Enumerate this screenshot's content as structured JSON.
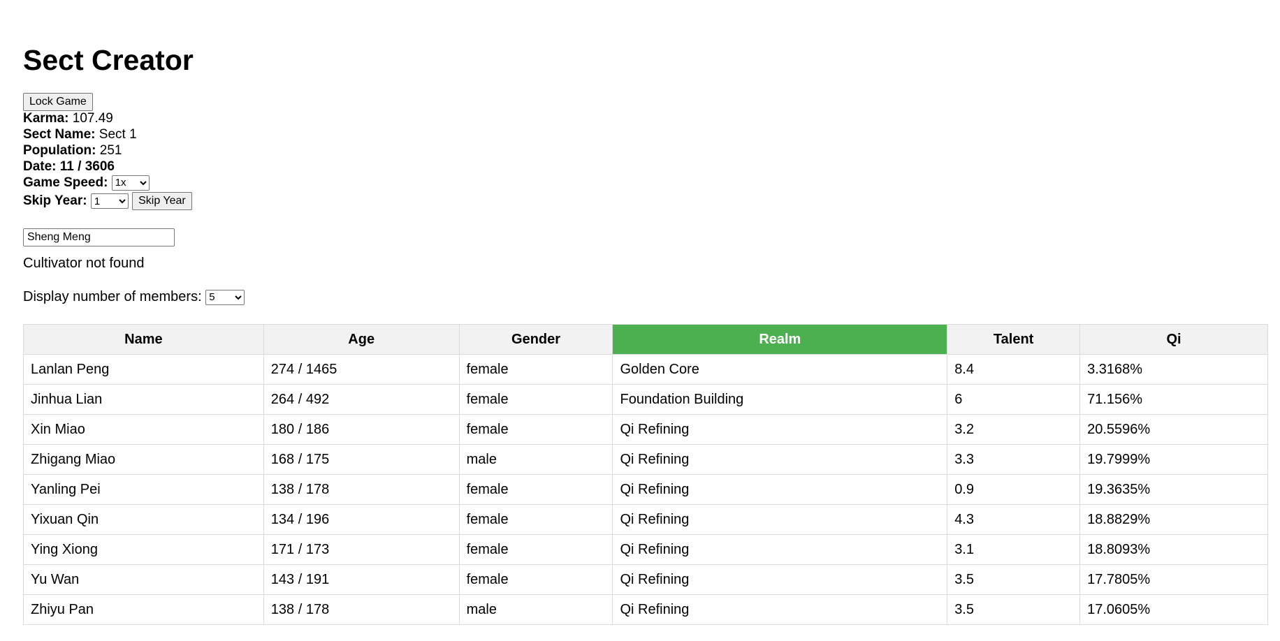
{
  "app": {
    "title": "Sect Creator"
  },
  "controls": {
    "lock_button": "Lock Game",
    "karma_label": "Karma:",
    "karma_value": "107.49",
    "sect_name_label": "Sect Name:",
    "sect_name_value": "Sect 1",
    "population_label": "Population:",
    "population_value": "251",
    "date_text": "Date: 11 / 3606",
    "game_speed_label": "Game Speed:",
    "game_speed_value": "1x",
    "skip_year_label": "Skip Year:",
    "skip_year_value": "1",
    "skip_year_button": "Skip Year"
  },
  "search": {
    "value": "Sheng Meng",
    "status": "Cultivator not found"
  },
  "display": {
    "label": "Display number of members:",
    "value": "5"
  },
  "table": {
    "headers": [
      "Name",
      "Age",
      "Gender",
      "Realm",
      "Talent",
      "Qi"
    ],
    "sorted_column": "Realm",
    "sorted_color": "#4caf50",
    "rows": [
      [
        "Lanlan Peng",
        "274 / 1465",
        "female",
        "Golden Core",
        "8.4",
        "3.3168%"
      ],
      [
        "Jinhua Lian",
        "264 / 492",
        "female",
        "Foundation Building",
        "6",
        "71.156%"
      ],
      [
        "Xin Miao",
        "180 / 186",
        "female",
        "Qi Refining",
        "3.2",
        "20.5596%"
      ],
      [
        "Zhigang Miao",
        "168 / 175",
        "male",
        "Qi Refining",
        "3.3",
        "19.7999%"
      ],
      [
        "Yanling Pei",
        "138 / 178",
        "female",
        "Qi Refining",
        "0.9",
        "19.3635%"
      ],
      [
        "Yixuan Qin",
        "134 / 196",
        "female",
        "Qi Refining",
        "4.3",
        "18.8829%"
      ],
      [
        "Ying Xiong",
        "171 / 173",
        "female",
        "Qi Refining",
        "3.1",
        "18.8093%"
      ],
      [
        "Yu Wan",
        "143 / 191",
        "female",
        "Qi Refining",
        "3.5",
        "17.7805%"
      ],
      [
        "Zhiyu Pan",
        "138 / 178",
        "male",
        "Qi Refining",
        "3.5",
        "17.0605%"
      ]
    ]
  }
}
